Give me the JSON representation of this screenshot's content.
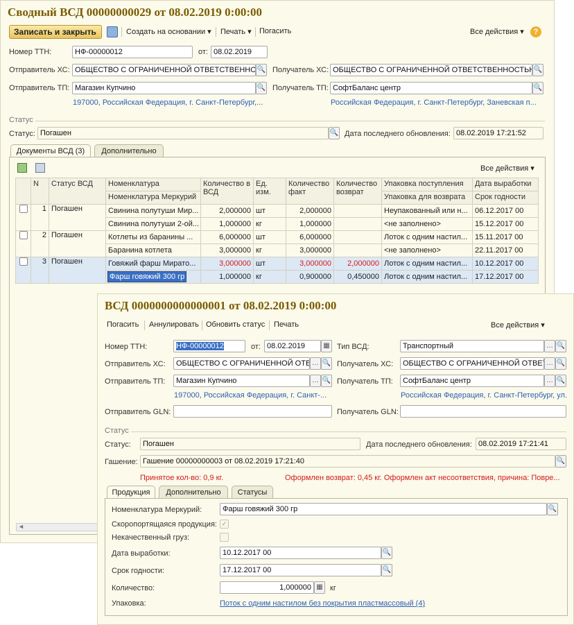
{
  "main": {
    "title": "Сводный ВСД 00000000029 от 08.02.2019 0:00:00",
    "toolbar": {
      "save_close": "Записать и закрыть",
      "create_based": "Создать на основании ▾",
      "print": "Печать ▾",
      "redeem": "Погасить",
      "all_actions": "Все действия ▾",
      "help": "?"
    },
    "ttn_label": "Номер ТТН:",
    "ttn_value": "НФ-00000012",
    "from_label": "от:",
    "from_value": "08.02.2019",
    "sender_hs_label": "Отправитель ХС:",
    "sender_hs_value": "ОБЩЕСТВО С ОГРАНИЧЕННОЙ ОТВЕТСТВЕННОСТЬЮ",
    "receiver_hs_label": "Получатель ХС:",
    "receiver_hs_value": "ОБЩЕСТВО С ОГРАНИЧЕННОЙ ОТВЕТСТВЕННОСТЬЮ",
    "sender_tp_label": "Отправитель ТП:",
    "sender_tp_value": "Магазин Купчино",
    "receiver_tp_label": "Получатель ТП:",
    "receiver_tp_value": "СофтБаланс центр",
    "sender_address": "197000, Российская Федерация, г. Санкт-Петербург,...",
    "receiver_address": "Российская Федерация, г. Санкт-Петербург, Заневская п...",
    "status_group": "Статус",
    "status_label": "Статус:",
    "status_value": "Погашен",
    "last_update_label": "Дата последнего обновления:",
    "last_update_value": "08.02.2019 17:21:52",
    "tabs": [
      "Документы ВСД (3)",
      "Дополнительно"
    ],
    "grid_all_actions": "Все действия ▾",
    "columns": {
      "n": "N",
      "status": "Статус ВСД",
      "nom": "Номенклатура",
      "nom_merc": "Номенклатура Меркурий",
      "qty_vsd": "Количество в ВСД",
      "unit": "Ед. изм.",
      "qty_fact": "Количество факт",
      "qty_return": "Количество возврат",
      "pack_in": "Упаковка поступления",
      "pack_ret": "Упаковка для возврата",
      "prod_date": "Дата выработки",
      "exp_date": "Срок годности"
    },
    "rows": [
      {
        "n": "1",
        "status": "Погашен",
        "l1": {
          "nom": "Свинина полутуши Мир...",
          "qty": "2,000000",
          "unit": "шт",
          "fact": "2,000000",
          "ret": "",
          "pack": "Неупакованный или н...",
          "date": "06.12.2017 00"
        },
        "l2": {
          "nom": "Свинина полутуши 2-ой...",
          "qty": "1,000000",
          "unit": "кг",
          "fact": "1,000000",
          "ret": "",
          "pack": "<не заполнено>",
          "date": "15.12.2017 00"
        }
      },
      {
        "n": "2",
        "status": "Погашен",
        "l1": {
          "nom": "Котлеты из баранины ...",
          "qty": "6,000000",
          "unit": "шт",
          "fact": "6,000000",
          "ret": "",
          "pack": "Лоток с одним настил...",
          "date": "15.11.2017 00"
        },
        "l2": {
          "nom": "Баранина котлета",
          "qty": "3,000000",
          "unit": "кг",
          "fact": "3,000000",
          "ret": "",
          "pack": "<не заполнено>",
          "date": "22.11.2017 00"
        }
      },
      {
        "n": "3",
        "status": "Погашен",
        "l1": {
          "nom": "Говяжий фарш Мирато...",
          "qty": "3,000000",
          "unit": "шт",
          "fact": "3,000000",
          "ret": "2,000000",
          "pack": "Лоток с одним настил...",
          "date": "10.12.2017 00"
        },
        "l2": {
          "nom": "Фарш говяжий 300 гр",
          "qty": "1,000000",
          "unit": "кг",
          "fact": "0,900000",
          "ret": "0,450000",
          "pack": "Лоток с одним настил...",
          "date": "17.12.2017 00"
        }
      }
    ]
  },
  "detail": {
    "title": "ВСД 0000000000000001 от 08.02.2019 0:00:00",
    "toolbar": {
      "redeem": "Погасить",
      "cancel": "Аннулировать",
      "refresh": "Обновить статус",
      "print": "Печать",
      "all_actions": "Все действия ▾"
    },
    "ttn_label": "Номер ТТН:",
    "ttn_value": "НФ-00000012",
    "from_label": "от:",
    "from_value": "08.02.2019",
    "type_label": "Тип ВСД:",
    "type_value": "Транспортный",
    "sender_hs_label": "Отправитель ХС:",
    "sender_hs_value": "ОБЩЕСТВО С ОГРАНИЧЕННОЙ ОТВЕТСТВЕННОСТЬЮ",
    "receiver_hs_label": "Получатель ХС:",
    "receiver_hs_value": "ОБЩЕСТВО С ОГРАНИЧЕННОЙ ОТВЕТСТВЕННОСТЬЮ",
    "sender_tp_label": "Отправитель ТП:",
    "sender_tp_value": "Магазин Купчино",
    "receiver_tp_label": "Получатель ТП:",
    "receiver_tp_value": "СофтБаланс центр",
    "sender_address": "197000, Российская Федерация, г. Санкт-...",
    "receiver_address": "Российская Федерация, г. Санкт-Петербург, ул. ...",
    "sender_gln_label": "Отправитель GLN:",
    "receiver_gln_label": "Получатель GLN:",
    "status_group": "Статус",
    "status_label": "Статус:",
    "status_value": "Погашен",
    "last_update_label": "Дата последнего обновления:",
    "last_update_value": "08.02.2019 17:21:41",
    "redemption_label": "Гашение:",
    "redemption_value": "Гашение 00000000003 от 08.02.2019 17:21:40",
    "accepted_note": "Принятое кол-во: 0,9 кг.",
    "return_note": "Оформлен возврат: 0,45 кг. Оформлен акт несоответствия, причина: Повре...",
    "tabs": [
      "Продукция",
      "Дополнительно",
      "Статусы"
    ],
    "nom_merc_label": "Номенклатура Меркурий:",
    "nom_merc_value": "Фарш говяжий 300 гр",
    "perishable_label": "Скоропортящаяся продукция:",
    "poor_quality_label": "Некачественный груз:",
    "prod_date_label": "Дата выработки:",
    "prod_date_value": "10.12.2017 00",
    "exp_date_label": "Срок годности:",
    "exp_date_value": "17.12.2017 00",
    "qty_label": "Количество:",
    "qty_value": "1,000000",
    "qty_unit": "кг",
    "pack_label": "Упаковка:",
    "pack_value": "Поток с одним настилом без покрытия пластмассовый (4)"
  }
}
